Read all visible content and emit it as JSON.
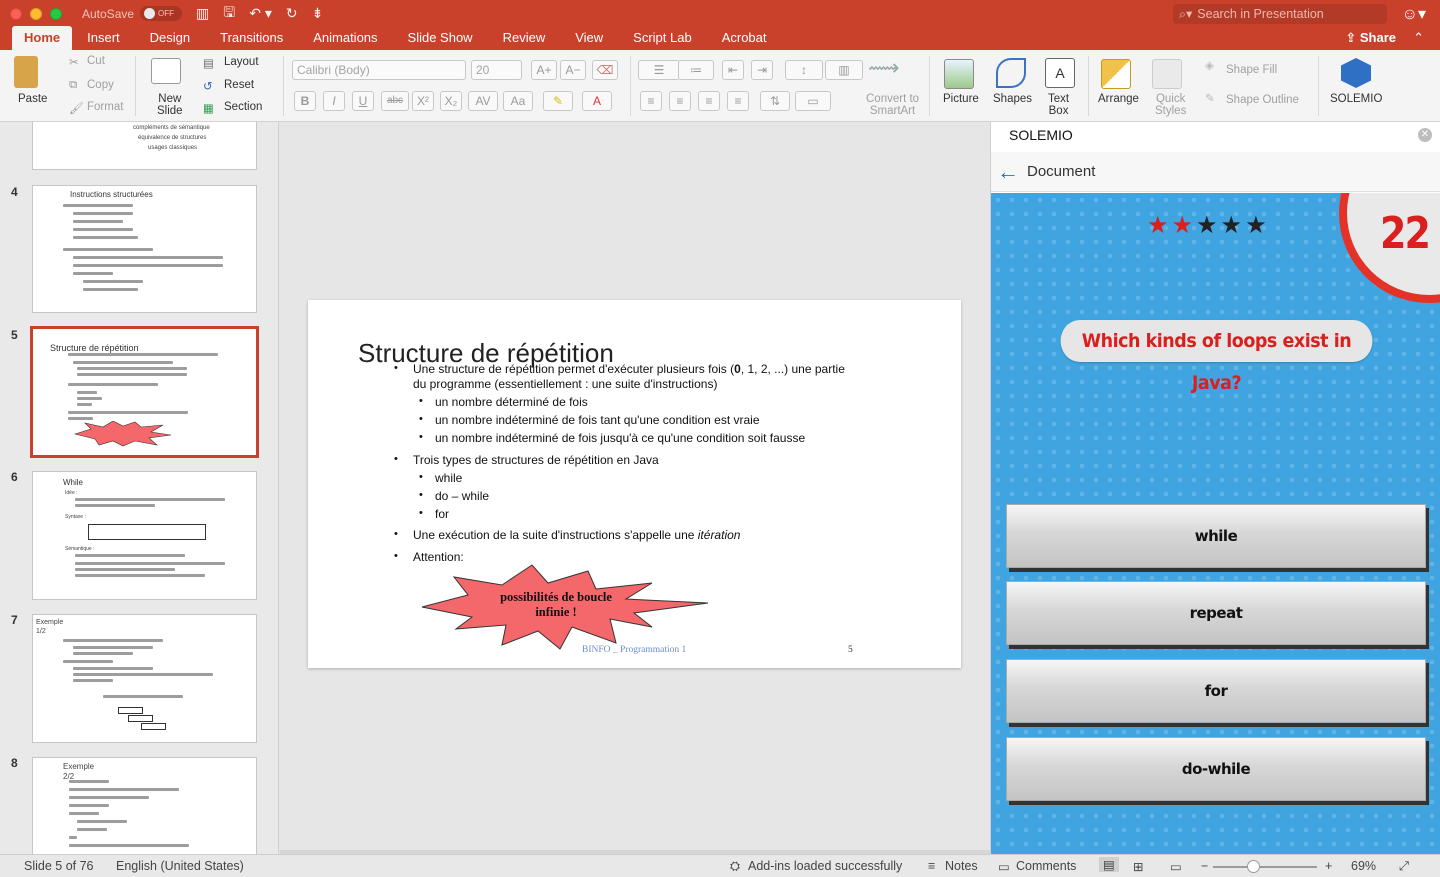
{
  "titlebar": {
    "autosave_label": "AutoSave",
    "autosave_state": "OFF",
    "search_placeholder": "Search in Presentation"
  },
  "ribbon_tabs": [
    "Home",
    "Insert",
    "Design",
    "Transitions",
    "Animations",
    "Slide Show",
    "Review",
    "View",
    "Script Lab",
    "Acrobat"
  ],
  "share_label": "Share",
  "ribbon": {
    "paste": "Paste",
    "cut": "Cut",
    "copy": "Copy",
    "format": "Format",
    "new_slide": "New\nSlide",
    "layout": "Layout",
    "reset": "Reset",
    "section": "Section",
    "font_name": "Calibri (Body)",
    "font_size": "20",
    "convert_smartart": "Convert to\nSmartArt",
    "picture": "Picture",
    "shapes": "Shapes",
    "text_box": "Text\nBox",
    "arrange": "Arrange",
    "quick_styles": "Quick\nStyles",
    "shape_fill": "Shape Fill",
    "shape_outline": "Shape Outline",
    "solemio": "SOLEMIO"
  },
  "thumbnails": [
    {
      "num": "4",
      "title": "Instructions structurées"
    },
    {
      "num": "5",
      "title": "Structure de répétition",
      "starburst": "possibilités de\nboucle infinie !"
    },
    {
      "num": "6",
      "title": "While",
      "idee": "Idée :",
      "syntaxe": "Syntaxe :",
      "semantique": "Sémantique :"
    },
    {
      "num": "7",
      "title": "Exemple",
      "sub": "1/2"
    },
    {
      "num": "8",
      "title": "Exemple",
      "sub": "2/2"
    }
  ],
  "top_thumb_lines": [
    "compléments de sémantique",
    "équivalence de structures",
    "usages classiques"
  ],
  "slide": {
    "title": "Structure de répétition",
    "b1_a": "Une structure de répétition permet d'exécuter plusieurs fois (",
    "b1_nums": "0",
    "b1_b": ", 1, 2, ...) une partie",
    "b1_c": "du programme (essentiellement : une suite d'instructions)",
    "s1": "un nombre déterminé de fois",
    "s2": "un nombre indéterminé de fois tant qu'une condition est vraie",
    "s3": "un nombre indéterminé de fois jusqu'à ce qu'une condition soit fausse",
    "b2": "Trois types de structures de répétition en Java",
    "t1": "while",
    "t2": "do – while",
    "t3": "for",
    "b3_a": "Une exécution de la suite d'instructions s'appelle une ",
    "b3_b": "itération",
    "b4": "Attention:",
    "burst": "possibilités de boucle infinie !",
    "footer": "BINFO _ Programmation 1",
    "page": "5"
  },
  "pane": {
    "title": "SOLEMIO",
    "nav": "Document",
    "stars_filled": 2,
    "stars_total": 5,
    "timer": "22",
    "question": "Which kinds of loops exist in Java?",
    "answers": [
      "while",
      "repeat",
      "for",
      "do-while"
    ]
  },
  "status": {
    "slide_of": "Slide 5 of 76",
    "language": "English (United States)",
    "addins": "Add-ins loaded successfully",
    "notes": "Notes",
    "comments": "Comments",
    "zoom": "69%"
  },
  "colors": {
    "accent": "#c9412b",
    "game_bg": "#3fa4e0",
    "question_red": "#d9201f",
    "burst_fill": "#f4676a"
  }
}
